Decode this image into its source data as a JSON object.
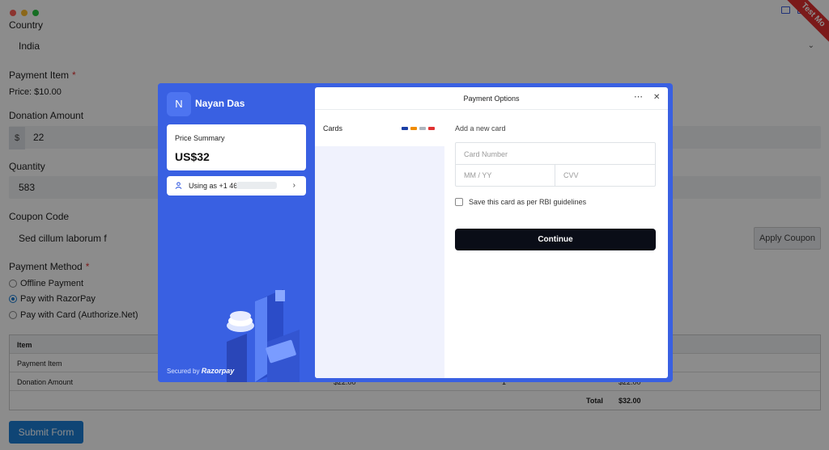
{
  "mode_badge": "Test Mo",
  "form": {
    "country_label": "Country",
    "country_value": "India",
    "payment_item_label": "Payment Item",
    "required_mark": "*",
    "payment_item_price": "Price: $10.00",
    "donation_label": "Donation Amount",
    "currency_prefix": "$",
    "donation_value": "22",
    "quantity_label": "Quantity",
    "quantity_value": "583",
    "coupon_label": "Coupon Code",
    "coupon_value": "Sed cillum laborum f",
    "apply_coupon": "Apply Coupon",
    "payment_method_label": "Payment Method",
    "methods": [
      {
        "label": "Offline Payment",
        "selected": false
      },
      {
        "label": "Pay with RazorPay",
        "selected": true
      },
      {
        "label": "Pay with Card (Authorize.Net)",
        "selected": false
      }
    ],
    "table": {
      "header": "Item",
      "rows": [
        {
          "item": "Payment Item",
          "price": "",
          "qty": "",
          "total": ""
        },
        {
          "item": "Donation Amount",
          "price": "$22.00",
          "qty": "1",
          "total": "$22.00"
        }
      ],
      "total_label": "Total",
      "total_value": "$32.00"
    },
    "submit": "Submit Form"
  },
  "checkout": {
    "merchant_initial": "N",
    "merchant_name": "Nayan Das",
    "price_summary_label": "Price Summary",
    "price_amount": "US$32",
    "using_as": "Using as +1 46",
    "secured_by": "Secured by",
    "razorpay": "Razorpay",
    "panel_title": "Payment Options",
    "more_icon": "⋯",
    "close_icon": "✕",
    "tab_cards": "Cards",
    "add_new_card": "Add a new card",
    "card_number_placeholder": "Card Number",
    "expiry_placeholder": "MM / YY",
    "cvv_placeholder": "CVV",
    "save_card_label": "Save this card as per RBI guidelines",
    "continue_label": "Continue",
    "accent": "#3960e2"
  }
}
